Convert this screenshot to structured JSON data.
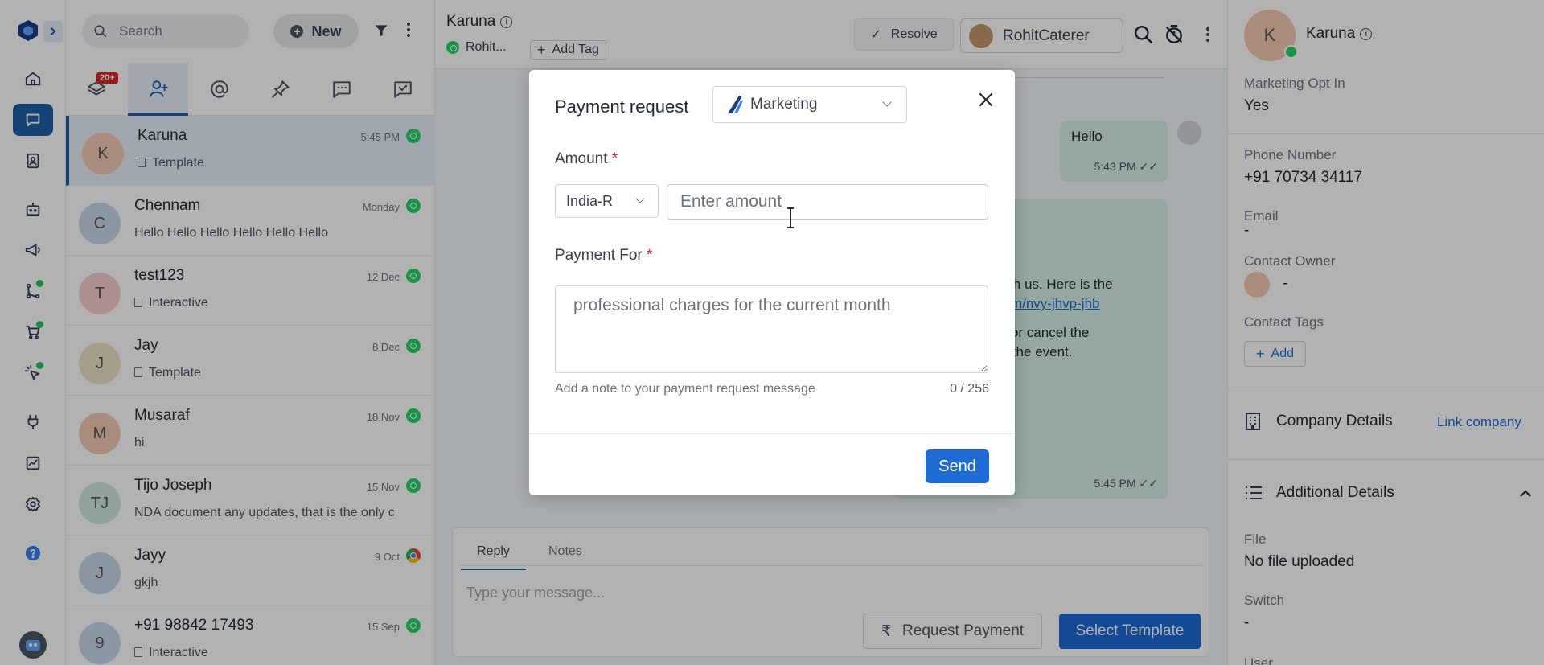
{
  "search": {
    "placeholder": "Search"
  },
  "toolbar": {
    "new_label": "New"
  },
  "tabs": {
    "badge": "20+"
  },
  "conversations": [
    {
      "name": "Karuna",
      "time": "5:45 PM",
      "preview": "Template",
      "initials": "K",
      "color": "#f1cbb7",
      "channel": "whatsapp",
      "doc": true
    },
    {
      "name": "Chennam",
      "time": "Monday",
      "preview": "Hello Hello Hello Hello Hello Hello",
      "initials": "C",
      "color": "#c9d7ea",
      "channel": "whatsapp",
      "doc": false
    },
    {
      "name": "test123",
      "time": "12 Dec",
      "preview": "Interactive",
      "initials": "T",
      "color": "#f6cfcf",
      "channel": "whatsapp",
      "doc": true
    },
    {
      "name": "Jay",
      "time": "8 Dec",
      "preview": "Template",
      "initials": "J",
      "color": "#ece2c7",
      "channel": "whatsapp",
      "doc": true
    },
    {
      "name": "Musaraf",
      "time": "18 Nov",
      "preview": "hi",
      "initials": "M",
      "color": "#f1cbb7",
      "channel": "whatsapp",
      "doc": false
    },
    {
      "name": "Tijo Joseph",
      "time": "15 Nov",
      "preview": "NDA document any updates, that is the only c",
      "initials": "TJ",
      "color": "#cfe8dd",
      "channel": "whatsapp",
      "doc": false
    },
    {
      "name": "Jayy",
      "time": "9 Oct",
      "preview": "gkjh",
      "initials": "J",
      "color": "#c9d7ea",
      "channel": "chrome",
      "doc": false
    },
    {
      "name": "+91 98842 17493",
      "time": "15 Sep",
      "preview": "Interactive",
      "initials": "9",
      "color": "#c9d7ea",
      "channel": "whatsapp",
      "doc": true
    }
  ],
  "chat": {
    "title": "Karuna",
    "tag": "Rohit...",
    "add_tag": "Add Tag",
    "resolve": "Resolve",
    "assignee": "RohitCaterer",
    "msg_hello": "Hello",
    "msg_hello_time": "5:43 PM",
    "msg_line1": "with us. Here is the",
    "msg_link": "com/nvy-jhvp-jhb",
    "msg_line3": "le or cancel the",
    "msg_line4": "re the event.",
    "msg_time": "5:45 PM"
  },
  "composer": {
    "reply": "Reply",
    "notes": "Notes",
    "placeholder": "Type your message...",
    "request_payment": "Request Payment",
    "select_template": "Select Template"
  },
  "contact": {
    "initial": "K",
    "name": "Karuna",
    "optin_label": "Marketing Opt In",
    "optin_value": "Yes",
    "phone_label": "Phone Number",
    "phone_value": "+91 70734 34117",
    "email_label": "Email",
    "email_value": "-",
    "owner_label": "Contact Owner",
    "owner_value": "-",
    "tags_label": "Contact Tags",
    "add": "Add",
    "company": "Company Details",
    "link_company": "Link company",
    "additional": "Additional Details",
    "file_label": "File",
    "file_value": "No file uploaded",
    "switch_label": "Switch",
    "switch_value": "-",
    "user_label": "User"
  },
  "modal": {
    "title": "Payment request",
    "category": "Marketing",
    "amount_label": "Amount",
    "required": "*",
    "currency": "India-R",
    "amount_placeholder": "Enter amount",
    "payment_for_label": "Payment For",
    "payment_for_placeholder": "professional charges for the current month",
    "hint": "Add a note to your payment request message",
    "counter": "0 / 256",
    "send": "Send"
  }
}
